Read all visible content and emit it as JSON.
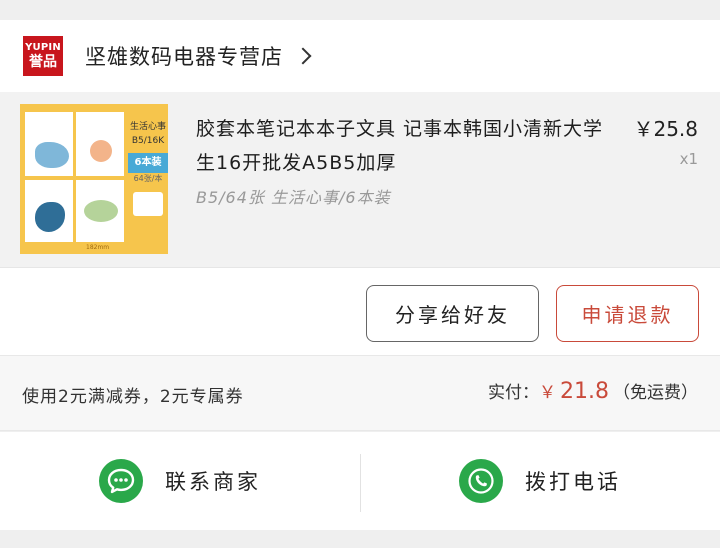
{
  "store": {
    "logo_line1": "YUPIN",
    "logo_line2": "誉品",
    "name": "坚雄数码电器专营店",
    "chevron_icon": "chevron-right-icon"
  },
  "product": {
    "thumbnail": {
      "label": "生活心事",
      "format": "B5/16K",
      "pack": "6本装",
      "sheets": "64张/本",
      "size_note": "182mm"
    },
    "title": "胶套本笔记本本子文具 记事本韩国小清新大学生16开批发A5B5加厚",
    "price": "￥25.8",
    "quantity": "x1",
    "variant": "B5/64张 生活心事/6本装"
  },
  "actions": {
    "share_label": "分享给好友",
    "refund_label": "申请退款"
  },
  "summary": {
    "coupon_text": "使用2元满减券，2元专属券",
    "paid_label": "实付：",
    "currency": "￥",
    "paid_amount": "21.8",
    "shipping_note": "（免运费）"
  },
  "contact": {
    "seller_label": "联系商家",
    "seller_icon": "chat-bubble-icon",
    "phone_label": "拨打电话",
    "phone_icon": "phone-icon",
    "icon_color": "#2aa84a"
  },
  "colors": {
    "accent_red": "#c94a3a",
    "brand_red": "#c8161d"
  }
}
